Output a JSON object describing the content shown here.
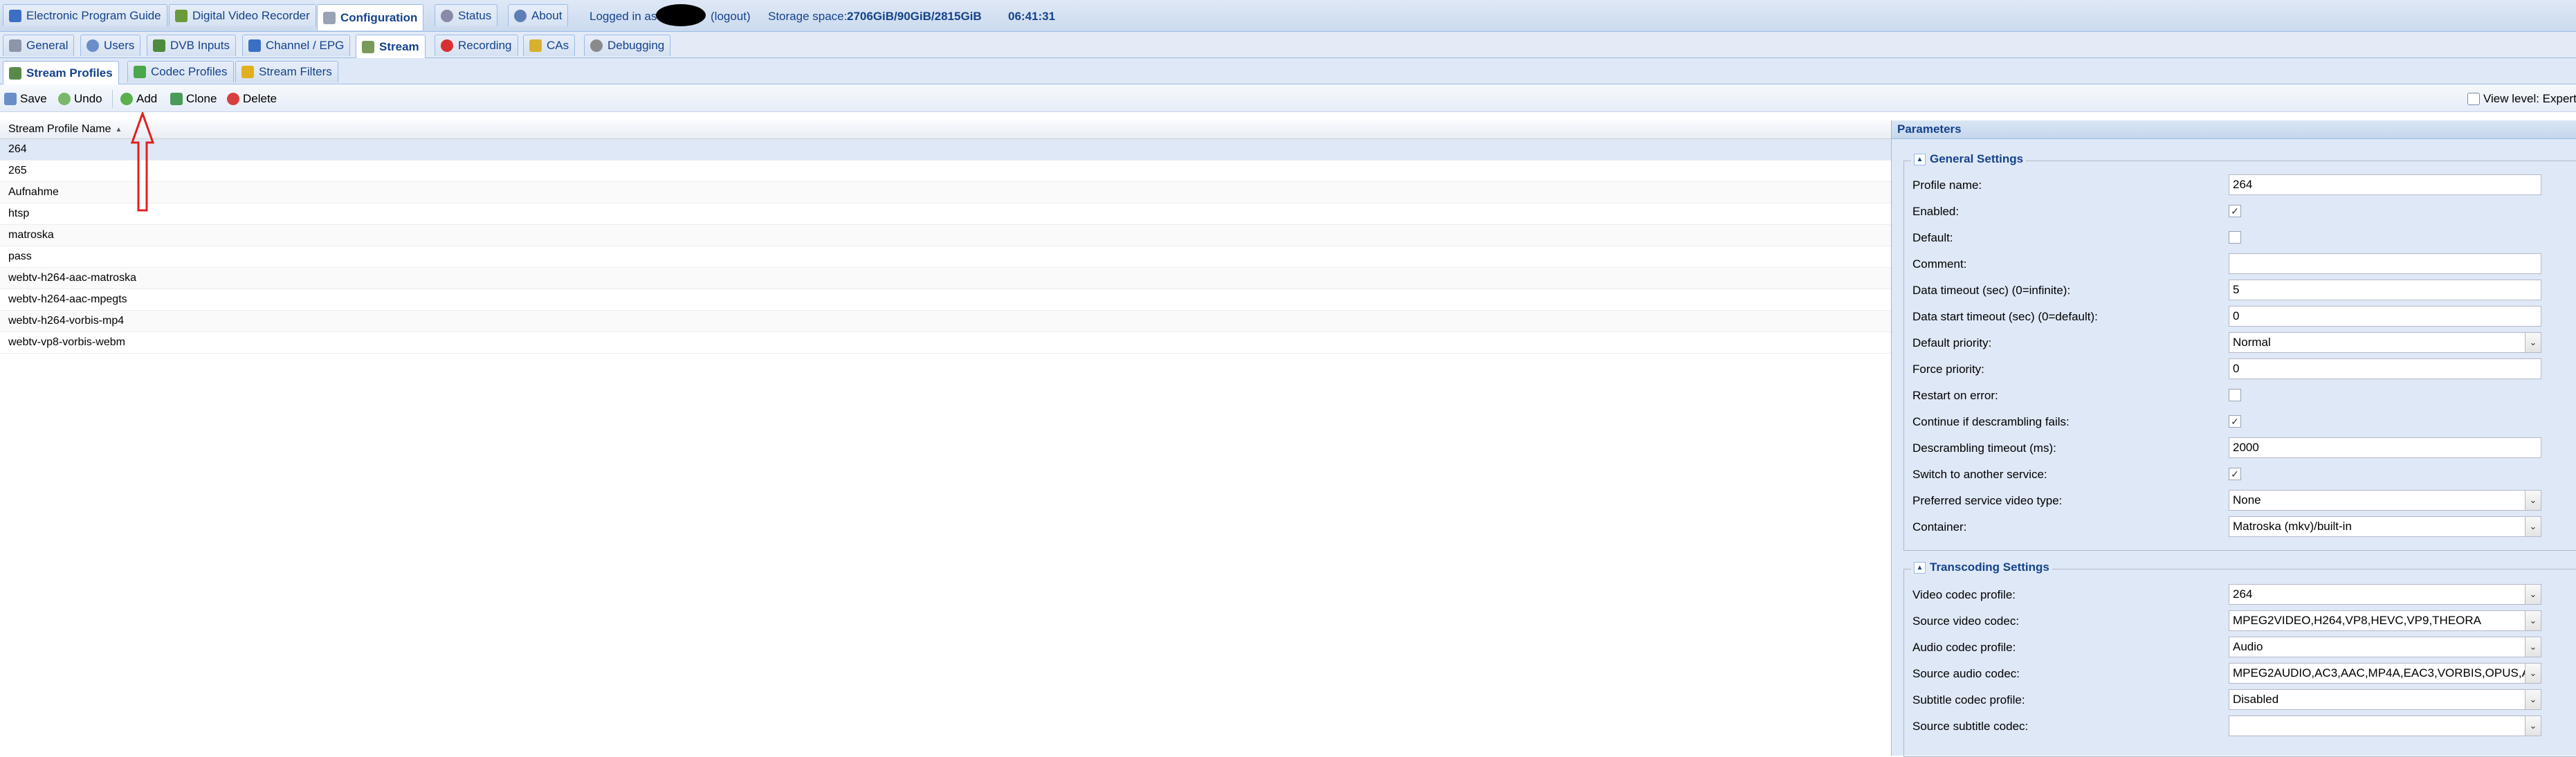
{
  "top_tabs": [
    {
      "label": "Electronic Program Guide",
      "icon": "epg-icon"
    },
    {
      "label": "Digital Video Recorder",
      "icon": "dvr-icon"
    },
    {
      "label": "Configuration",
      "icon": "wrench-icon"
    },
    {
      "label": "Status",
      "icon": "status-icon"
    },
    {
      "label": "About",
      "icon": "info-icon"
    }
  ],
  "session": {
    "logged_in_as": "Logged in as",
    "logout": "(logout)",
    "storage_label": "Storage space:",
    "storage_value": "2706GiB/90GiB/2815GiB",
    "time": "06:41:31"
  },
  "config_tabs": [
    {
      "label": "General"
    },
    {
      "label": "Users"
    },
    {
      "label": "DVB Inputs"
    },
    {
      "label": "Channel / EPG"
    },
    {
      "label": "Stream"
    },
    {
      "label": "Recording"
    },
    {
      "label": "CAs"
    },
    {
      "label": "Debugging"
    }
  ],
  "stream_tabs": [
    {
      "label": "Stream Profiles"
    },
    {
      "label": "Codec Profiles"
    },
    {
      "label": "Stream Filters"
    }
  ],
  "toolbar": {
    "save": "Save",
    "undo": "Undo",
    "add": "Add",
    "clone": "Clone",
    "delete": "Delete",
    "view_level": "View level: Expert"
  },
  "grid": {
    "column": "Stream Profile Name",
    "sort": "▲",
    "rows": [
      "264",
      "265",
      "Aufnahme",
      "htsp",
      "matroska",
      "pass",
      "webtv-h264-aac-matroska",
      "webtv-h264-aac-mpegts",
      "webtv-h264-vorbis-mp4",
      "webtv-vp8-vorbis-webm"
    ]
  },
  "params": {
    "title": "Parameters",
    "general_title": "General Settings",
    "profile_name_label": "Profile name:",
    "profile_name": "264",
    "enabled_label": "Enabled:",
    "enabled_checked": true,
    "default_label": "Default:",
    "default_checked": false,
    "comment_label": "Comment:",
    "comment": "",
    "data_timeout_label": "Data timeout (sec) (0=infinite):",
    "data_timeout": "5",
    "data_start_timeout_label": "Data start timeout (sec) (0=default):",
    "data_start_timeout": "0",
    "default_priority_label": "Default priority:",
    "default_priority": "Normal",
    "force_priority_label": "Force priority:",
    "force_priority": "0",
    "restart_label": "Restart on error:",
    "restart_checked": false,
    "continue_label": "Continue if descrambling fails:",
    "continue_checked": true,
    "descrambling_timeout_label": "Descrambling timeout (ms):",
    "descrambling_timeout": "2000",
    "switch_label": "Switch to another service:",
    "switch_checked": true,
    "preferred_label": "Preferred service video type:",
    "preferred": "None",
    "container_label": "Container:",
    "container": "Matroska (mkv)/built-in",
    "transcoding_title": "Transcoding Settings",
    "video_codec_profile_label": "Video codec profile:",
    "video_codec_profile": "264",
    "source_video_codec_label": "Source video codec:",
    "source_video_codec": "MPEG2VIDEO,H264,VP8,HEVC,VP9,THEORA",
    "audio_codec_profile_label": "Audio codec profile:",
    "audio_codec_profile": "Audio",
    "source_audio_codec_label": "Source audio codec:",
    "source_audio_codec": "MPEG2AUDIO,AC3,AAC,MP4A,EAC3,VORBIS,OPUS,A",
    "subtitle_codec_profile_label": "Subtitle codec profile:",
    "subtitle_codec_profile": "Disabled",
    "source_subtitle_codec_label": "Source subtitle codec:",
    "source_subtitle_codec": ""
  },
  "colors": {
    "accent": "#15428b",
    "annotation_arrow": "#e02020"
  }
}
